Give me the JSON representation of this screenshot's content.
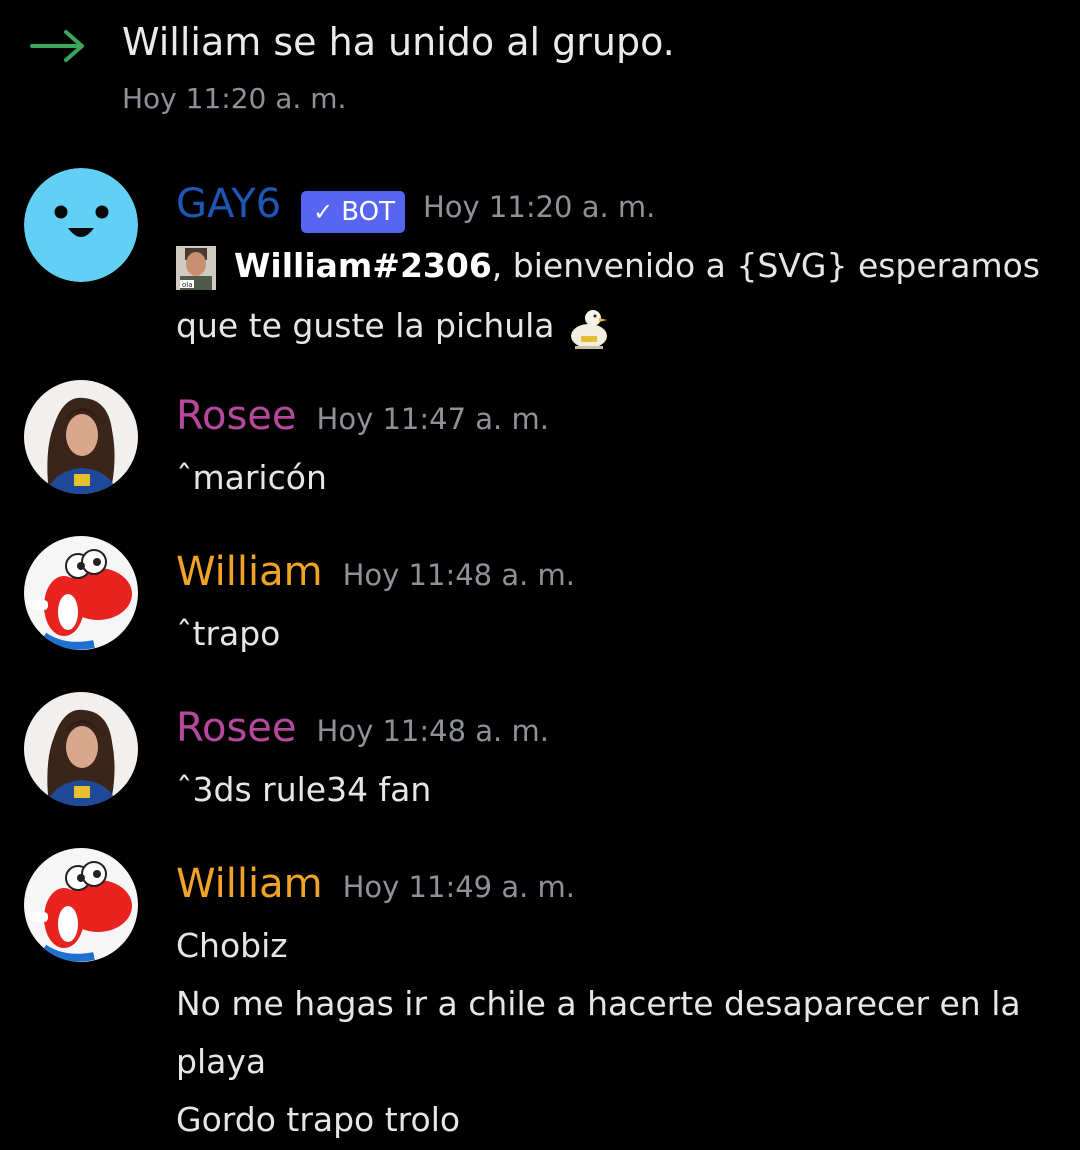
{
  "system": {
    "join_text": "William se ha unido al grupo.",
    "join_time": "Hoy 11:20 a. m.",
    "arrow_color": "#3ba55d"
  },
  "messages": [
    {
      "author": "GAY6",
      "author_color": "#1d57b8",
      "bot_tag": "BOT",
      "bot_check": "✓",
      "time": "Hoy 11:20 a. m.",
      "avatar": "smiley-avatar",
      "mention": "William#2306",
      "mention_emoji_text": "ola",
      "lines": [
        ", bienvenido a {SVG} esperamos",
        "que te guste la pichula"
      ],
      "trailing_emoji": "duck-emoji"
    },
    {
      "author": "Rosee",
      "author_color": "#b8479e",
      "time": "Hoy 11:47 a. m.",
      "avatar": "girl-avatar",
      "lines": [
        "ˆmaricón"
      ]
    },
    {
      "author": "William",
      "author_color": "#f1a325",
      "time": "Hoy 11:48 a. m.",
      "avatar": "yoshi-avatar",
      "lines": [
        "ˆtrapo"
      ]
    },
    {
      "author": "Rosee",
      "author_color": "#b8479e",
      "time": "Hoy 11:48 a. m.",
      "avatar": "girl-avatar",
      "lines": [
        "ˆ3ds rule34 fan"
      ]
    },
    {
      "author": "William",
      "author_color": "#f1a325",
      "time": "Hoy 11:49 a. m.",
      "avatar": "yoshi-avatar",
      "lines": [
        "Chobiz",
        "No me hagas ir a chile a hacerte desaparecer en la",
        "playa",
        "Gordo trapo trolo"
      ]
    }
  ]
}
